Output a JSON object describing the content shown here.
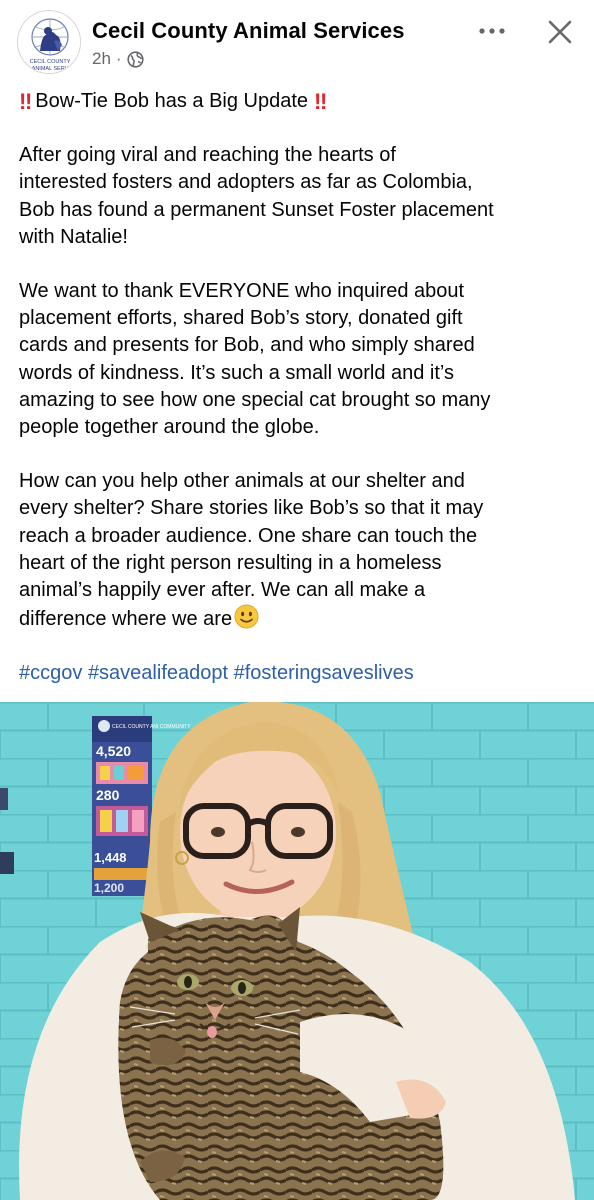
{
  "post": {
    "page_name": "Cecil County Animal Services",
    "time_ago": "2h",
    "separator": "·",
    "visibility_icon": "globe-icon",
    "avatar_text": [
      "CECIL COUNTY",
      "ANIMAL SERV"
    ],
    "title": "Bow-Tie Bob has a Big Update",
    "title_emoji": "‼",
    "paragraphs": [
      [
        "After going viral and reaching the hearts of",
        "interested fosters and adopters as far as Colombia,",
        "Bob has found a permanent Sunset Foster placement",
        "with Natalie!"
      ],
      [
        "We want to thank EVERYONE who inquired about",
        "placement efforts, shared Bob’s story, donated gift",
        "cards and presents for Bob, and who simply shared",
        "words of kindness. It’s such a small world and it’s",
        "amazing to see how one special cat brought so many",
        "people together around the globe."
      ],
      [
        "How can you help other animals at our shelter and",
        "every shelter? Share stories like Bob’s so that it may",
        "reach a broader audience. One share can touch the",
        "heart of the right person resulting in a homeless",
        "animal’s happily ever after. We can all make a",
        "difference where we are"
      ]
    ],
    "hashtags": [
      "#ccgov",
      "#savealifeadopt",
      "#fosteringsaveslives"
    ],
    "poster_text": {
      "header": "CECIL COUNTY ANI COMMUNITY",
      "n1": "4,520",
      "n2": "280",
      "n3": "1,448",
      "n4": "1,200"
    }
  },
  "colors": {
    "accent_red": "#e3262e",
    "hashtag_blue": "#2d5fa8",
    "meta_gray": "#65676b",
    "wall_teal": "#6ccfd4"
  },
  "icons": {
    "more": "more-horizontal-icon",
    "close": "close-icon",
    "smiley": "slightly-smiling-face-icon"
  }
}
